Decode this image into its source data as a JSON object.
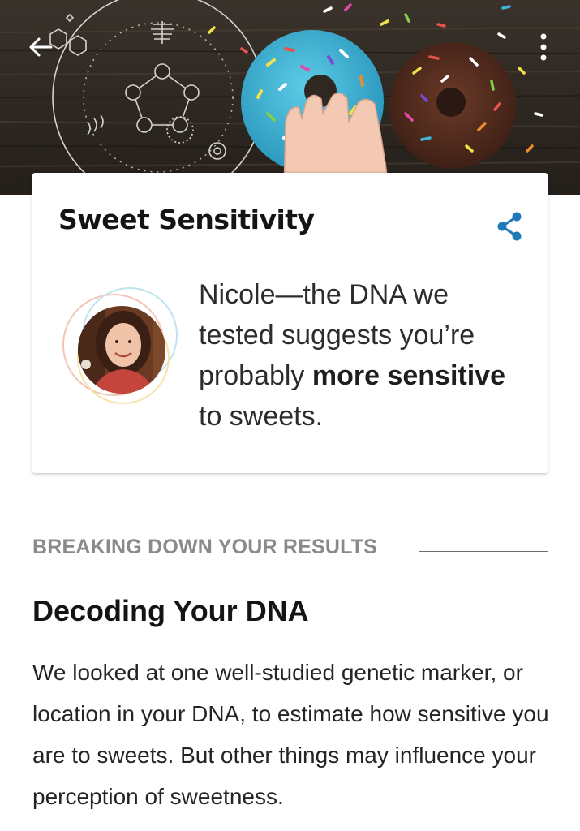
{
  "hero": {
    "background_color": "#2b2520",
    "donut_colors": [
      "#3fb6d8",
      "#5a2f22"
    ],
    "back_icon": "back-arrow-icon",
    "menu_icon": "more-vertical-icon"
  },
  "card": {
    "title": "Sweet Sensitivity",
    "share_icon": "share-icon",
    "accent_color": "#1f7ab8",
    "result_prefix": "Nicole—the DNA we tested suggests you’re probably ",
    "result_emphasis": "more sensitive",
    "result_suffix": " to sweets."
  },
  "section": {
    "label": "BREAKING DOWN YOUR RESULTS"
  },
  "article": {
    "title": "Decoding Your DNA",
    "body": "We looked at one well-studied genetic marker, or location in your DNA, to estimate how sensitive you are to sweets. But other things may influence your perception of sweetness."
  }
}
